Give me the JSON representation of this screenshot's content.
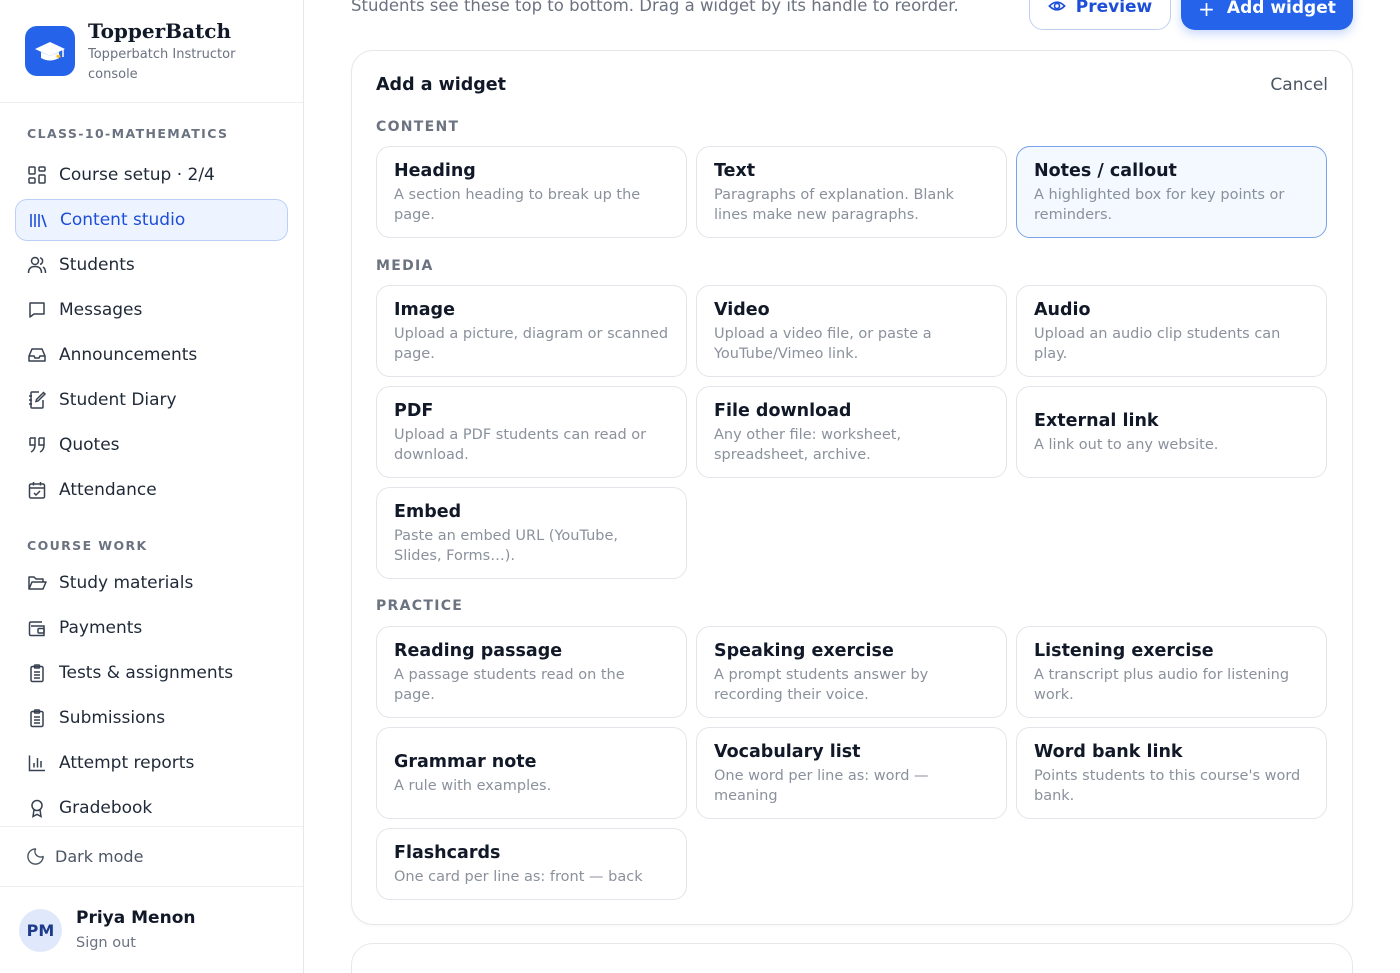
{
  "brand": {
    "name": "TopperBatch",
    "subtitle": "Topperbatch Instructor console"
  },
  "sidebar": {
    "section1": "CLASS-10-MATHEMATICS",
    "items1": [
      {
        "label": "Course setup · 2/4",
        "icon": "grid-icon"
      },
      {
        "label": "Content studio",
        "icon": "library-icon",
        "active": true
      },
      {
        "label": "Students",
        "icon": "users-icon"
      },
      {
        "label": "Messages",
        "icon": "message-icon"
      },
      {
        "label": "Announcements",
        "icon": "inbox-icon"
      },
      {
        "label": "Student Diary",
        "icon": "notebook-pen-icon"
      },
      {
        "label": "Quotes",
        "icon": "quote-icon"
      },
      {
        "label": "Attendance",
        "icon": "calendar-check-icon"
      }
    ],
    "section2": "COURSE WORK",
    "items2": [
      {
        "label": "Study materials",
        "icon": "folder-open-icon"
      },
      {
        "label": "Payments",
        "icon": "wallet-icon"
      },
      {
        "label": "Tests & assignments",
        "icon": "clipboard-list-icon"
      },
      {
        "label": "Submissions",
        "icon": "clipboard-list-icon"
      },
      {
        "label": "Attempt reports",
        "icon": "bar-chart-icon"
      },
      {
        "label": "Gradebook",
        "icon": "award-icon"
      }
    ],
    "dark_mode": "Dark mode",
    "profile": {
      "initials": "PM",
      "name": "Priya Menon",
      "sign_out": "Sign out"
    }
  },
  "header": {
    "instruction": "Students see these top to bottom. Drag a widget by its handle to reorder.",
    "preview_label": "Preview",
    "add_widget_label": "Add widget"
  },
  "panel": {
    "title": "Add a widget",
    "cancel": "Cancel",
    "groups": [
      {
        "name": "CONTENT",
        "cards": [
          {
            "title": "Heading",
            "desc": "A section heading to break up the page."
          },
          {
            "title": "Text",
            "desc": "Paragraphs of explanation. Blank lines make new paragraphs."
          },
          {
            "title": "Notes / callout",
            "desc": "A highlighted box for key points or reminders.",
            "selected": true
          }
        ]
      },
      {
        "name": "MEDIA",
        "cards": [
          {
            "title": "Image",
            "desc": "Upload a picture, diagram or scanned page."
          },
          {
            "title": "Video",
            "desc": "Upload a video file, or paste a YouTube/Vimeo link."
          },
          {
            "title": "Audio",
            "desc": "Upload an audio clip students can play."
          },
          {
            "title": "PDF",
            "desc": "Upload a PDF students can read or download."
          },
          {
            "title": "File download",
            "desc": "Any other file: worksheet, spreadsheet, archive."
          },
          {
            "title": "External link",
            "desc": "A link out to any website."
          },
          {
            "title": "Embed",
            "desc": "Paste an embed URL (YouTube, Slides, Forms…)."
          }
        ]
      },
      {
        "name": "PRACTICE",
        "cards": [
          {
            "title": "Reading passage",
            "desc": "A passage students read on the page."
          },
          {
            "title": "Speaking exercise",
            "desc": "A prompt students answer by recording their voice."
          },
          {
            "title": "Listening exercise",
            "desc": "A transcript plus audio for listening work."
          },
          {
            "title": "Grammar note",
            "desc": "A rule with examples."
          },
          {
            "title": "Vocabulary list",
            "desc": "One word per line as: word — meaning"
          },
          {
            "title": "Word bank link",
            "desc": "Points students to this course's word bank."
          },
          {
            "title": "Flashcards",
            "desc": "One card per line as: front — back"
          }
        ]
      }
    ]
  },
  "colors": {
    "accent": "#2563eb",
    "active_bg": "#eef4ff",
    "muted_text": "#6b7280"
  }
}
